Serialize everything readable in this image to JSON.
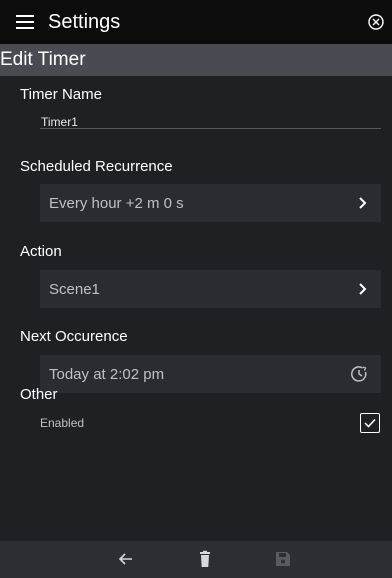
{
  "topbar": {
    "title": "Settings"
  },
  "subheader": {
    "title": "Edit Timer"
  },
  "form": {
    "timer_name_label": "Timer Name",
    "timer_name_value": "Timer1",
    "recurrence_label": "Scheduled Recurrence",
    "recurrence_value": "Every hour +2 m 0 s",
    "action_label": "Action",
    "action_value": "Scene1",
    "next_label": "Next Occurence",
    "next_value": "Today at 2:02 pm",
    "other_label": "Other",
    "enabled_label": "Enabled",
    "enabled_checked": true
  },
  "icons": {
    "menu": "menu-icon",
    "close": "close-circle-icon",
    "chevron": "chevron-right-icon",
    "clock": "clock-icon",
    "back": "arrow-left-icon",
    "delete": "trash-icon",
    "save": "save-icon"
  },
  "colors": {
    "topbar": "#0c0c0d",
    "subheader": "#4a4b52",
    "background": "#1f2024",
    "row": "#2b2c31",
    "bottombar": "#2d2e33"
  }
}
